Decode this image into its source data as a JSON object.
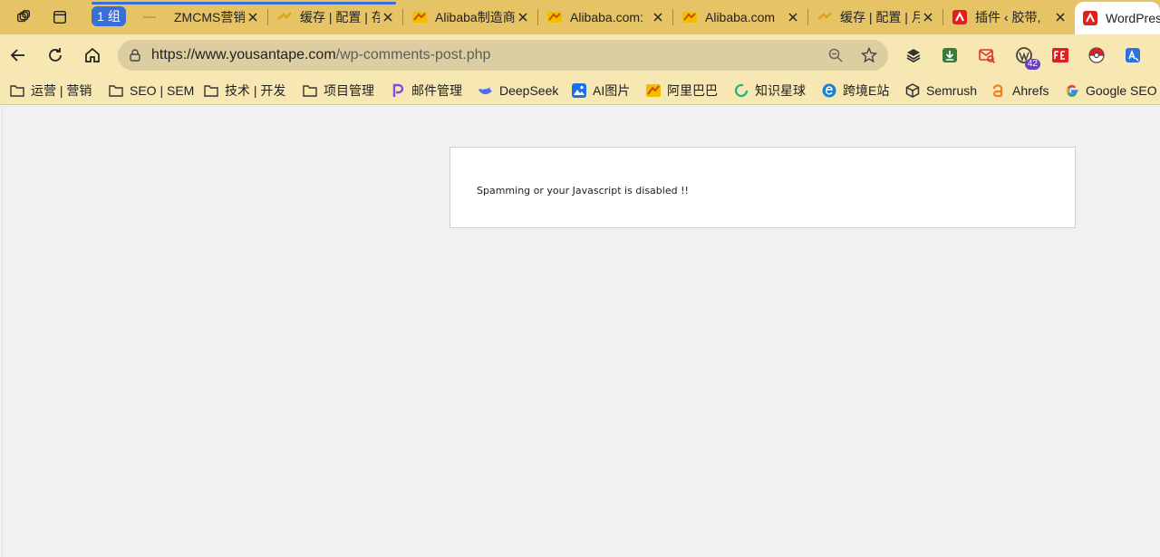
{
  "tabstrip": {
    "group_label": "1 组",
    "tabs": [
      {
        "title": "ZMCMS营销管"
      },
      {
        "title": "缓存 | 配置 | 存"
      },
      {
        "title": "Alibaba制造商"
      },
      {
        "title": "Alibaba.com:"
      },
      {
        "title": "Alibaba.com"
      },
      {
        "title": "缓存 | 配置 | 月"
      },
      {
        "title": "插件 ‹ 胶带,"
      },
      {
        "title": "WordPress"
      }
    ]
  },
  "address_bar": {
    "url_host": "https://www.yousantape.com",
    "url_path": "/wp-comments-post.php"
  },
  "extensions": {
    "wp_badge": "42"
  },
  "bookmarks": [
    {
      "label": "运营 | 营销"
    },
    {
      "label": "SEO | SEM"
    },
    {
      "label": "技术 | 开发"
    },
    {
      "label": "项目管理"
    },
    {
      "label": "邮件管理"
    },
    {
      "label": "DeepSeek"
    },
    {
      "label": "AI图片"
    },
    {
      "label": "阿里巴巴"
    },
    {
      "label": "知识星球"
    },
    {
      "label": "跨境E站"
    },
    {
      "label": "Semrush"
    },
    {
      "label": "Ahrefs"
    },
    {
      "label": "Google SEO"
    }
  ],
  "page": {
    "message": "Spamming or your Javascript is disabled !!"
  },
  "colors": {
    "tabstrip": "#e6c364",
    "toolbar": "#f6e7b3",
    "group": "#3a6fd8"
  }
}
